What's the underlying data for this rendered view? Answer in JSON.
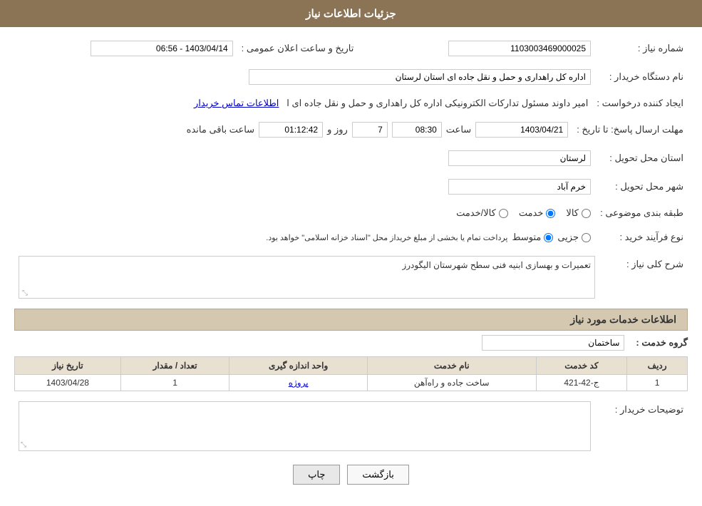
{
  "header": {
    "title": "جزئیات اطلاعات نیاز"
  },
  "fields": {
    "need_number_label": "شماره نیاز :",
    "need_number_value": "1103003469000025",
    "announce_datetime_label": "تاریخ و ساعت اعلان عمومی :",
    "announce_datetime_value": "1403/04/14 - 06:56",
    "buyer_org_label": "نام دستگاه خریدار :",
    "buyer_org_value": "اداره کل راهداری و حمل و نقل جاده ای استان لرستان",
    "creator_label": "ایجاد کننده درخواست :",
    "creator_value": "امیر داوند مسئول تدارکات الکترونیکی  اداره کل راهداری و حمل و نقل جاده ای ا",
    "contact_link": "اطلاعات تماس خریدار",
    "deadline_label": "مهلت ارسال پاسخ: تا تاریخ :",
    "deadline_date": "1403/04/21",
    "deadline_time": "08:30",
    "deadline_days": "7",
    "deadline_days_label": "روز و",
    "deadline_remaining": "01:12:42",
    "deadline_remaining_label": "ساعت باقی مانده",
    "province_label": "استان محل تحویل :",
    "province_value": "لرستان",
    "city_label": "شهر محل تحویل :",
    "city_value": "خرم آباد",
    "category_label": "طبقه بندی موضوعی :",
    "category_options": [
      {
        "id": "kala",
        "label": "کالا"
      },
      {
        "id": "khadamat",
        "label": "خدمت"
      },
      {
        "id": "kala_khadamat",
        "label": "کالا/خدمت"
      }
    ],
    "category_selected": "khadamat",
    "purchase_type_label": "نوع فرآیند خرید :",
    "purchase_options": [
      {
        "id": "jozii",
        "label": "جزیی"
      },
      {
        "id": "motavasset",
        "label": "متوسط"
      }
    ],
    "purchase_note": "پرداخت تمام یا بخشی از مبلغ خریداز محل \"اسناد خزانه اسلامی\" خواهد بود.",
    "description_label": "شرح کلی نیاز :",
    "description_value": "تعمیرات و بهسازی ابنیه فنی سطح شهرستان الیگودرز"
  },
  "services_section": {
    "title": "اطلاعات خدمات مورد نیاز",
    "service_group_label": "گروه خدمت :",
    "service_group_value": "ساختمان",
    "table_headers": [
      "ردیف",
      "کد خدمت",
      "نام خدمت",
      "واحد اندازه گیری",
      "تعداد / مقدار",
      "تاریخ نیاز"
    ],
    "table_rows": [
      {
        "row_num": "1",
        "service_code": "ج-42-421",
        "service_name": "ساخت جاده و راه‌آهن",
        "unit": "پروژه",
        "quantity": "1",
        "date": "1403/04/28"
      }
    ]
  },
  "buyer_desc": {
    "label": "توضیحات خریدار :",
    "value": ""
  },
  "buttons": {
    "print": "چاپ",
    "back": "بازگشت"
  }
}
